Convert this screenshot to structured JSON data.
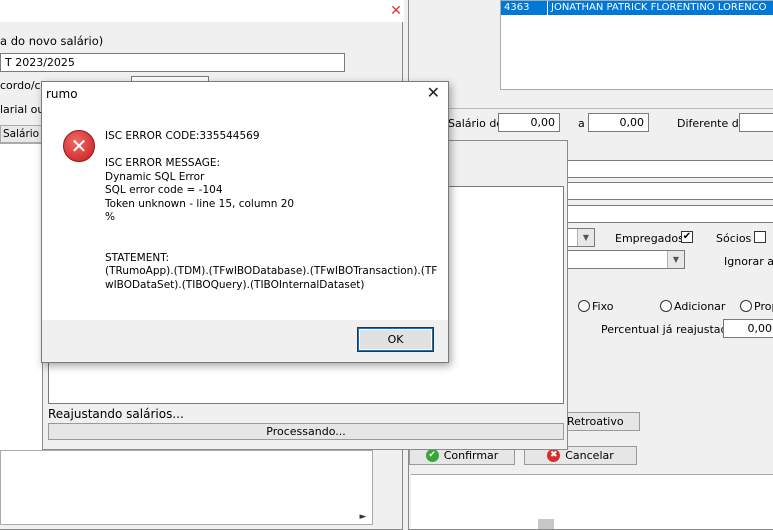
{
  "error_dialog": {
    "title": "rumo",
    "code_line": "ISC ERROR CODE:335544569",
    "message_header": "ISC ERROR MESSAGE:",
    "message_lines": [
      "Dynamic SQL Error",
      "SQL error code = -104",
      "Token unknown - line 15, column 20",
      "%"
    ],
    "statement_header": "STATEMENT:",
    "statement_lines": [
      "(TRumoApp).(TDM).(TFwIBODatabase).(TFwIBOTransaction).(TF",
      "wIBODataSet).(TIBOQuery).(TIBOInternalDataset)"
    ],
    "ok_label": "OK",
    "icon": "error-icon"
  },
  "left_window": {
    "label_new_salary": "a do novo salário)",
    "field_period": "T 2023/2025",
    "label_acordo": "cordo/cc",
    "label_salarial": "larial ou r",
    "label_salario": "Salário A"
  },
  "progress_window": {
    "status": "Reajustando salários...",
    "progress_label": "Processando..."
  },
  "employee_row": {
    "id": "4363",
    "name": "JONATHAN PATRICK FLORENTINO LORENCO"
  },
  "filters": {
    "salario_de_label": "Salário de",
    "salario_de_value": "0,00",
    "a_label": "a",
    "a_value": "0,00",
    "diferente_label": "Diferente de",
    "empregados_label": "Empregados",
    "socios_label": "Sócios",
    "ignorar_label": "Ignorar ac",
    "radio_fixo": "Fixo",
    "radio_adicionar": "Adicionar",
    "radio_prop": "Prop",
    "percentual_label": "Percentual já reajustado",
    "percentual_value": "0,00",
    "retroativo_label": "Retroativo"
  },
  "actions": {
    "confirm_label": "Confirmar",
    "cancel_label": "Cancelar"
  },
  "colors": {
    "selection": "#0078d7",
    "error_red": "#d42e2e",
    "confirm_green": "#36a836"
  }
}
